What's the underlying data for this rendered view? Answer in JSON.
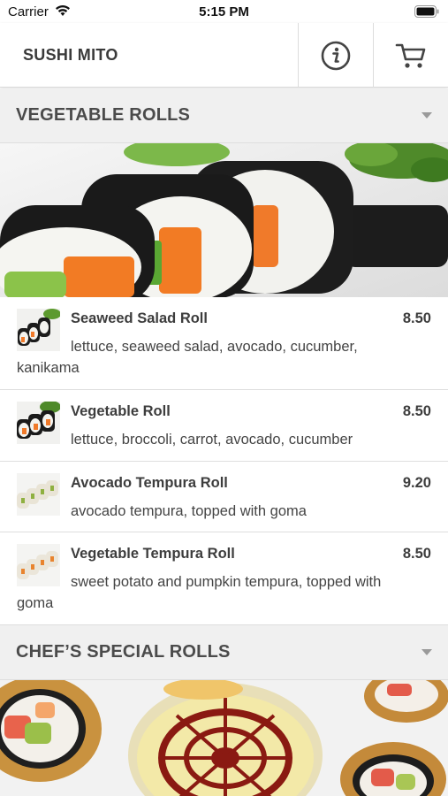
{
  "status_bar": {
    "carrier": "Carrier",
    "time": "5:15 PM"
  },
  "header": {
    "title": "SUSHI MITO",
    "info_icon": "info-icon",
    "cart_icon": "cart-icon"
  },
  "sections": [
    {
      "title": "VEGETABLE ROLLS",
      "items": [
        {
          "name": "Seaweed Salad Roll",
          "price": "8.50",
          "description": "lettuce, seaweed salad, avocado, cucumber, kanikama"
        },
        {
          "name": "Vegetable Roll",
          "price": "8.50",
          "description": "lettuce, broccoli, carrot, avocado, cucumber"
        },
        {
          "name": "Avocado Tempura Roll",
          "price": "9.20",
          "description": "avocado tempura, topped with goma"
        },
        {
          "name": "Vegetable Tempura Roll",
          "price": "8.50",
          "description": "sweet potato and pumpkin tempura, topped with goma"
        }
      ]
    },
    {
      "title": "CHEF’S SPECIAL ROLLS",
      "items": []
    }
  ],
  "colors": {
    "section_bg": "#f0f0f0",
    "text_dark": "#3d3d3d",
    "nori": "#1e1e1e",
    "carrot": "#f07a2a",
    "sauce": "#8a1a12"
  }
}
